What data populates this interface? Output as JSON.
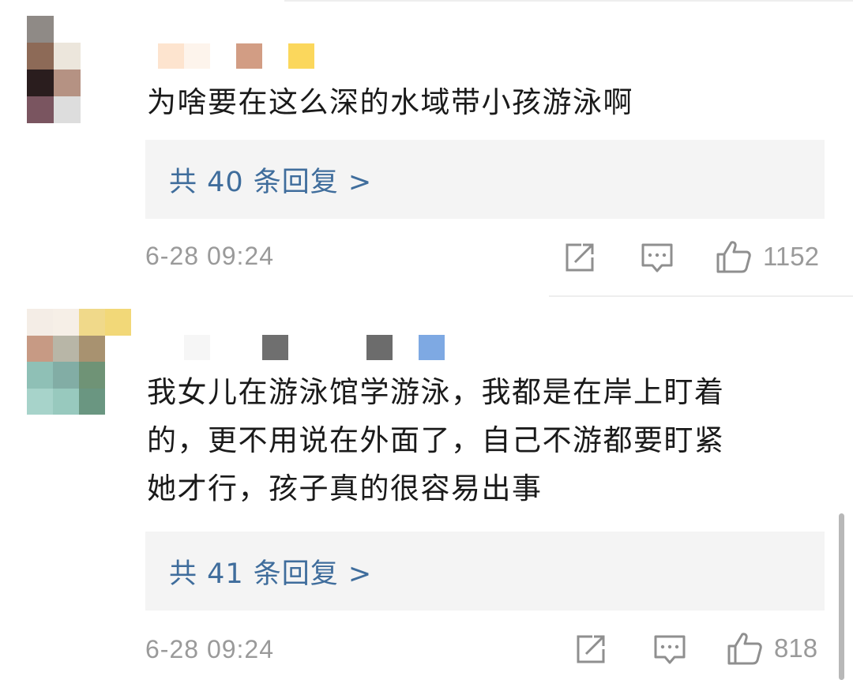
{
  "comments": [
    {
      "text": "为啥要在这么深的水域带小孩游泳啊",
      "replies_label": "共 40 条回复 >",
      "timestamp": "6-28 09:24",
      "like_count": "1152",
      "avatar": "pixelated-avatar",
      "username": "pixelated-username"
    },
    {
      "text_lines": [
        "我女儿在游泳馆学游泳，我都是在岸上盯着",
        "的，更不用说在外面了，自己不游都要盯紧",
        "她才行，孩子真的很容易出事"
      ],
      "replies_label": "共 41 条回复 >",
      "timestamp": "6-28 09:24",
      "like_count": "818",
      "avatar": "pixelated-avatar",
      "username": "pixelated-username"
    }
  ],
  "icons": {
    "share": "share-icon",
    "comment": "comment-icon",
    "like": "thumbs-up-icon"
  },
  "colors": {
    "reply_link": "#3f6d9c",
    "meta": "#9a9a9a",
    "reply_bg": "#f4f4f4"
  }
}
